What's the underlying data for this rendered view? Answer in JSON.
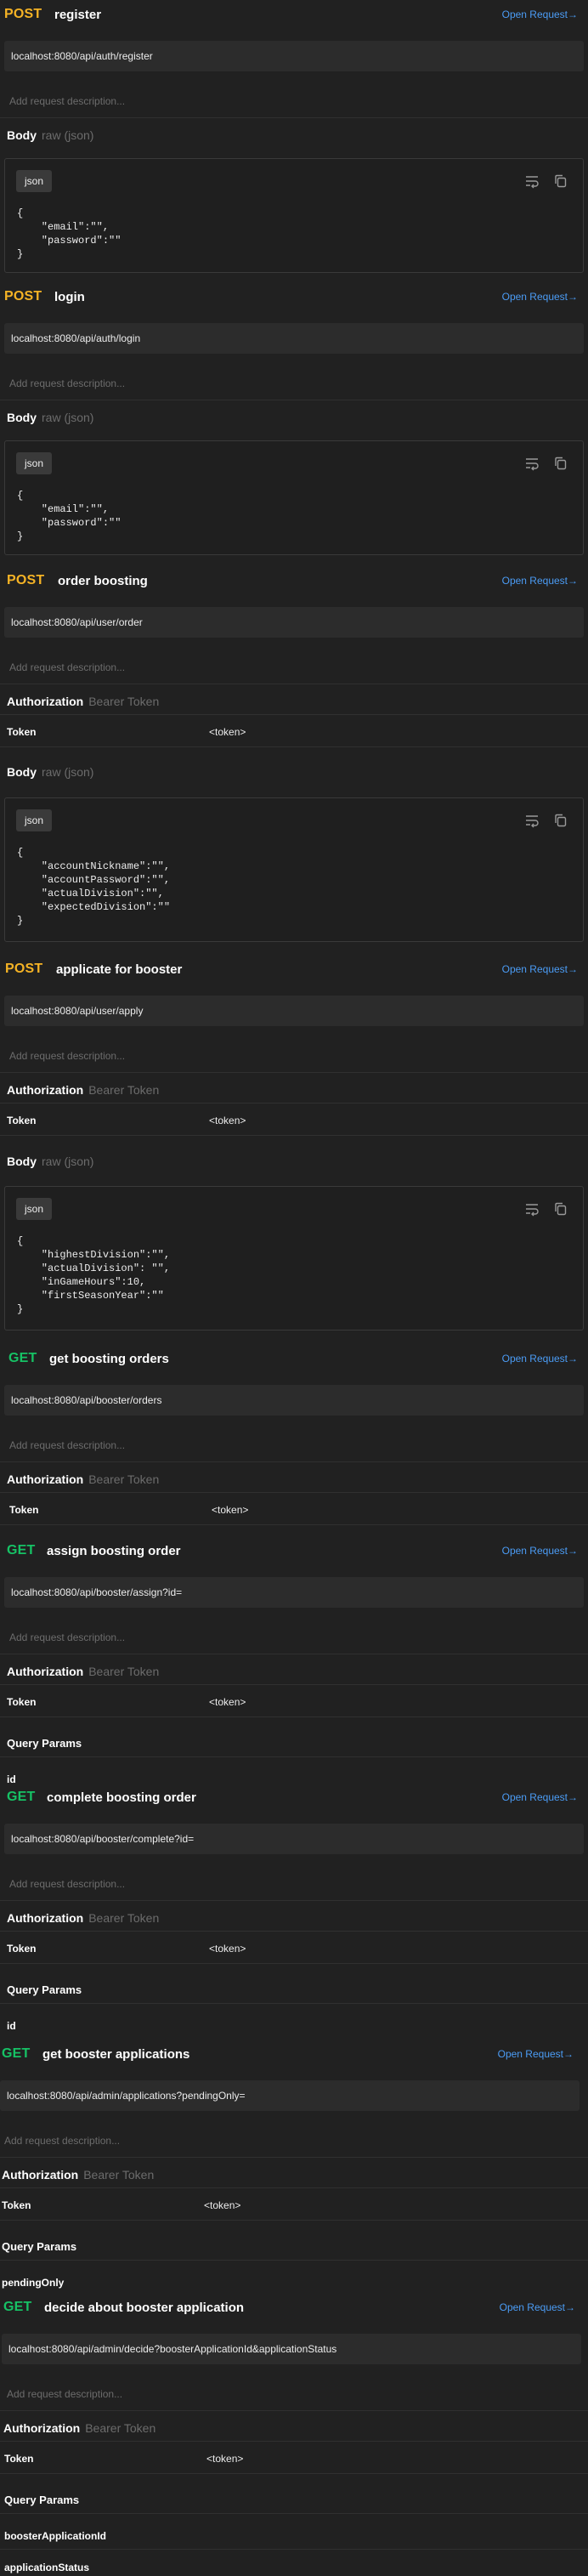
{
  "common": {
    "open_label": "Open Request→",
    "add_desc": "Add request description...",
    "body_label": "Body",
    "body_sub": "raw (json)",
    "auth_label": "Authorization",
    "auth_sub": "Bearer Token",
    "token_key": "Token",
    "token_val": "<token>",
    "query_label": "Query Params",
    "json_badge": "json"
  },
  "colors": {
    "post": "#f5b325",
    "get": "#16c265",
    "link": "#4b9cf5",
    "background": "#212121"
  },
  "icons": [
    "wrap-lines-icon",
    "copy-icon"
  ],
  "requests": [
    {
      "method": "POST",
      "name": "register",
      "url": "localhost:8080/api/auth/register",
      "body": [
        "{",
        "    \"email\":\"\",",
        "    \"password\":\"\"",
        "}"
      ]
    },
    {
      "method": "POST",
      "name": "login",
      "url": "localhost:8080/api/auth/login",
      "body": [
        "{",
        "    \"email\":\"\",",
        "    \"password\":\"\"",
        "}"
      ]
    },
    {
      "method": "POST",
      "name": "order boosting",
      "url": "localhost:8080/api/user/order",
      "body": [
        "{",
        "    \"accountNickname\":\"\",",
        "    \"accountPassword\":\"\",",
        "    \"actualDivision\":\"\",",
        "    \"expectedDivision\":\"\"",
        "}"
      ]
    },
    {
      "method": "POST",
      "name": "applicate for booster",
      "url": "localhost:8080/api/user/apply",
      "body": [
        "{",
        "    \"highestDivision\":\"\",",
        "    \"actualDivision\": \"\",",
        "    \"inGameHours\":10,",
        "    \"firstSeasonYear\":\"\"",
        "}"
      ]
    },
    {
      "method": "GET",
      "name": "get boosting orders",
      "url": "localhost:8080/api/booster/orders"
    },
    {
      "method": "GET",
      "name": "assign boosting order",
      "url": "localhost:8080/api/booster/assign?id=",
      "params": [
        "id"
      ]
    },
    {
      "method": "GET",
      "name": "complete boosting order",
      "url": "localhost:8080/api/booster/complete?id=",
      "params": [
        "id"
      ]
    },
    {
      "method": "GET",
      "name": "get booster applications",
      "url": "localhost:8080/api/admin/applications?pendingOnly=",
      "params": [
        "pendingOnly"
      ]
    },
    {
      "method": "GET",
      "name": "decide about booster application",
      "url": "localhost:8080/api/admin/decide?boosterApplicationId&applicationStatus",
      "params": [
        "boosterApplicationId",
        "applicationStatus"
      ]
    }
  ]
}
